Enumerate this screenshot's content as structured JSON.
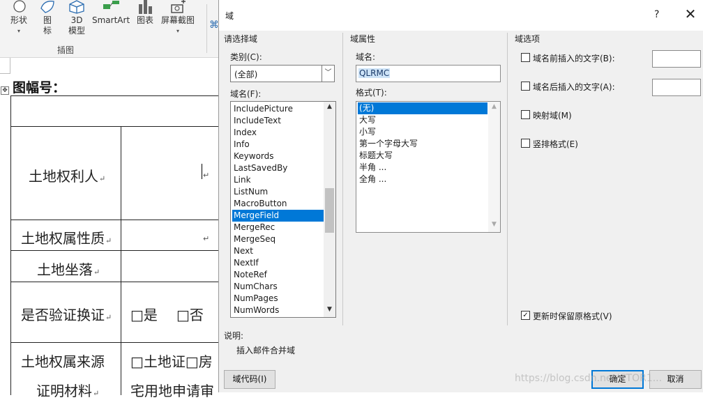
{
  "ribbon": {
    "items": [
      {
        "label": "形状",
        "icon": "shapes-icon"
      },
      {
        "label": "图标",
        "icon": "icons-icon"
      },
      {
        "label": "3D 模型",
        "icon": "3d-model-icon"
      },
      {
        "label": "SmartArt",
        "icon": "smartart-icon"
      },
      {
        "label": "图表",
        "icon": "chart-icon"
      },
      {
        "label": "屏幕截图",
        "icon": "screenshot-icon"
      }
    ],
    "group_label": "插图"
  },
  "document": {
    "heading": "图幅号：",
    "rows": [
      "土地权利人",
      "土地权属性质",
      "土地坐落",
      "是否验证换证",
      "土地权属来源",
      "证明材料"
    ],
    "checkbox_row": {
      "yes": "□是",
      "no": "□否"
    },
    "source_row_text": "□土地证□房",
    "cut_text": "宅用地申请审"
  },
  "dialog": {
    "title": "域",
    "help": "?",
    "close": "✕",
    "left_section": "请选择域",
    "category_label": "类别(C):",
    "category_value": "(全部)",
    "fieldnames_label": "域名(F):",
    "fieldnames": [
      "IncludePicture",
      "IncludeText",
      "Index",
      "Info",
      "Keywords",
      "LastSavedBy",
      "Link",
      "ListNum",
      "MacroButton",
      "MergeField",
      "MergeRec",
      "MergeSeq",
      "Next",
      "NextIf",
      "NoteRef",
      "NumChars",
      "NumPages",
      "NumWords"
    ],
    "selected_fieldname": "MergeField",
    "properties_section": "域属性",
    "fieldname_label": "域名:",
    "fieldname_value": "QLRMC",
    "format_label": "格式(T):",
    "formats": [
      "(无)",
      "大写",
      "小写",
      "第一个字母大写",
      "标题大写",
      "半角 ...",
      "全角 ..."
    ],
    "selected_format": "(无)",
    "options_section": "域选项",
    "options": [
      {
        "label": "域名前插入的文字(B):",
        "checked": false,
        "has_input": true
      },
      {
        "label": "域名后插入的文字(A):",
        "checked": false,
        "has_input": true
      },
      {
        "label": "映射域(M)",
        "checked": false,
        "has_input": false
      },
      {
        "label": "竖排格式(E)",
        "checked": false,
        "has_input": false
      }
    ],
    "preserve_label": "更新时保留原格式(V)",
    "preserve_checked": true,
    "description_label": "说明:",
    "description": "插入邮件合并域",
    "field_codes_button": "域代码(I)",
    "ok_button": "确定",
    "cancel_button": "取消"
  },
  "watermark": "https://blog.csdn.net/CTOR1..."
}
